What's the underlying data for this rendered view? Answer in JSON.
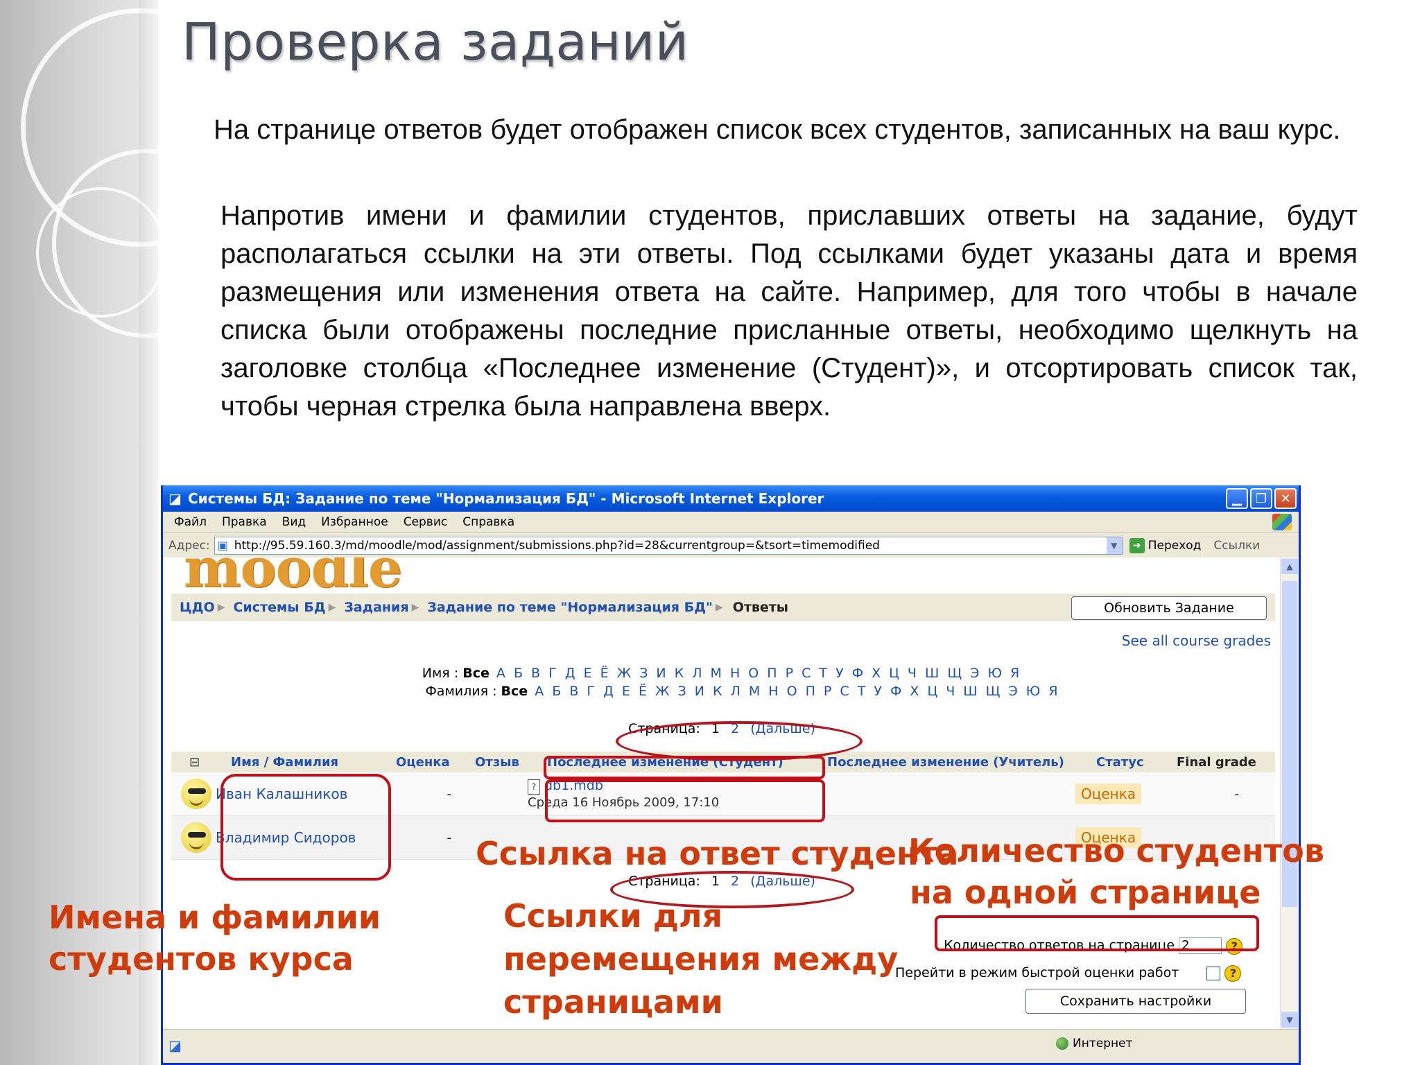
{
  "slide": {
    "title": "Проверка заданий",
    "para1": "На странице ответов будет отображен список всех студентов, записанных на ваш курс.",
    "para2": "Напротив имени и фамилии студентов, приславших ответы на задание, будут располагаться ссылки на эти ответы. Под ссылками будет указаны дата и время размещения или изменения ответа на сайте. Например, для того чтобы в начале списка были отображены последние присланные ответы, необходимо щелкнуть на заголовке столбца «Последнее изменение (Студент)», и отсортировать список так, чтобы черная стрелка была направлена вверх."
  },
  "browser": {
    "title": "Системы БД: Задание по теме \"Нормализация БД\" - Microsoft Internet Explorer",
    "menu": [
      "Файл",
      "Правка",
      "Вид",
      "Избранное",
      "Сервис",
      "Справка"
    ],
    "address_label": "Адрес:",
    "url": "http://95.59.160.3/md/moodle/mod/assignment/submissions.php?id=28&currentgroup=&tsort=timemodified",
    "go_label": "Переход",
    "links_label": "Ссылки",
    "status_zone": "Интернет"
  },
  "moodle": {
    "logo": "moodle",
    "breadcrumbs": [
      "ЦДО",
      "Системы БД",
      "Задания",
      "Задание по теме \"Нормализация БД\""
    ],
    "breadcrumb_current": "Ответы",
    "update_button": "Обновить Задание",
    "all_grades_link": "See all course grades",
    "firstname_label": "Имя :",
    "lastname_label": "Фамилия :",
    "all_label": "Все",
    "alphabet": "А Б В Г Д Е Ё Ж З И К Л М Н О П Р С Т У Ф Х Ц Ч Ш Щ Э Ю Я",
    "pages_label": "Страница:",
    "page1": "1",
    "page2": "2",
    "next_label": "(Дальше)",
    "columns": {
      "name": "Имя / Фамилия",
      "grade": "Оценка",
      "comment": "Отзыв",
      "last_student": "Последнее изменение (Студент)",
      "last_teacher": "Последнее изменение (Учитель)",
      "status": "Статус",
      "final": "Final grade"
    },
    "rows": [
      {
        "name": "Иван Калашников",
        "grade": "-",
        "file": "db1.mdb",
        "date": "Среда 16 Ноябрь 2009, 17:10",
        "status": "Оценка",
        "final": "-"
      },
      {
        "name": "Владимир Сидоров",
        "grade": "-",
        "file": "",
        "date": "",
        "status": "Оценка",
        "final": ""
      }
    ],
    "per_page_label": "Количество ответов на странице",
    "per_page_value": "2",
    "quick_grade_label": "Перейти в режим быстрой оценки работ",
    "save_button": "Сохранить настройки"
  },
  "annotations": {
    "answer_link": "Ссылка на ответ студента",
    "students_per_page_1": "Количество студентов",
    "students_per_page_2": "на одной странице",
    "names_1": "Имена и фамилии",
    "names_2": "студентов курса",
    "paging_1": "Ссылки для",
    "paging_2": "перемещения между",
    "paging_3": "страницами"
  },
  "colors": {
    "annotation": "#cf3b0a",
    "highlight_box": "#c0101a",
    "ie_titlebar": "#0a5ee0",
    "link": "#1f4fb4"
  }
}
